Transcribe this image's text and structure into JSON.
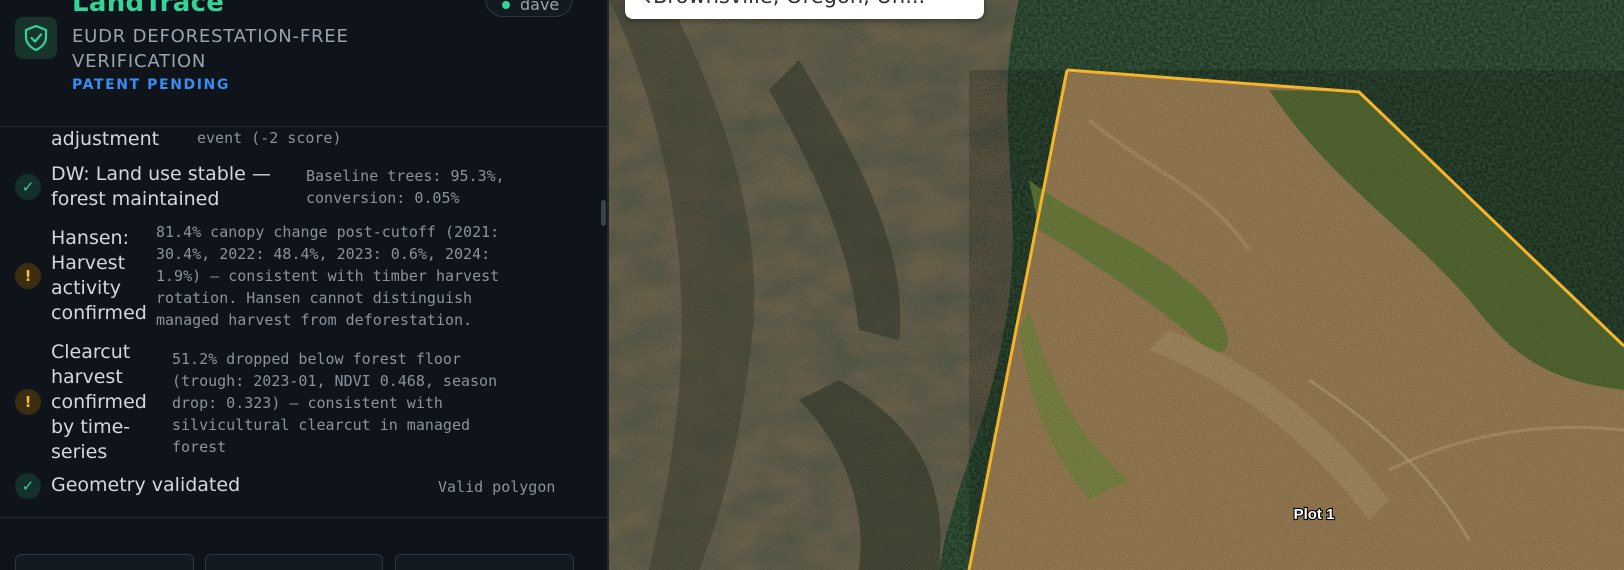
{
  "brand": {
    "name": "LandTrace",
    "subtitle_line1": "EUDR DEFORESTATION-FREE",
    "subtitle_line2": "VERIFICATION",
    "badge": "PATENT PENDING"
  },
  "user": {
    "name": "dave"
  },
  "checks": [
    {
      "status": "partial",
      "title_lines": [
        "adjustment"
      ],
      "detail_lines": [
        "event (-2 score)"
      ]
    },
    {
      "status": "pass",
      "title_lines": [
        "DW: Land use stable —",
        "forest maintained"
      ],
      "detail_lines": [
        "Baseline trees: 95.3%,",
        "conversion: 0.05%"
      ]
    },
    {
      "status": "warn",
      "title_lines": [
        "Hansen:",
        "Harvest",
        "activity",
        "confirmed"
      ],
      "detail_lines": [
        "81.4% canopy change post-cutoff (2021:",
        "30.4%, 2022: 48.4%, 2023: 0.6%, 2024:",
        "1.9%) — consistent with timber harvest",
        "rotation. Hansen cannot distinguish",
        "managed harvest from deforestation."
      ]
    },
    {
      "status": "warn",
      "title_lines": [
        "Clearcut",
        "harvest",
        "confirmed",
        "by time-",
        "series"
      ],
      "detail_lines": [
        "51.2% dropped below forest floor",
        "(trough: 2023-01, NDVI 0.468, season",
        "drop: 0.323) — consistent with",
        "silvicultural clearcut in managed",
        "forest"
      ]
    },
    {
      "status": "pass",
      "title_lines": [
        "Geometry validated"
      ],
      "detail_lines": [
        "Valid polygon"
      ]
    }
  ],
  "status_icons": {
    "pass": "✓",
    "warn": "!"
  },
  "map": {
    "search_text": "Brownsville, Oregon, Un...",
    "plot_label": "Plot 1",
    "polygon_color": "#f5b52a"
  }
}
